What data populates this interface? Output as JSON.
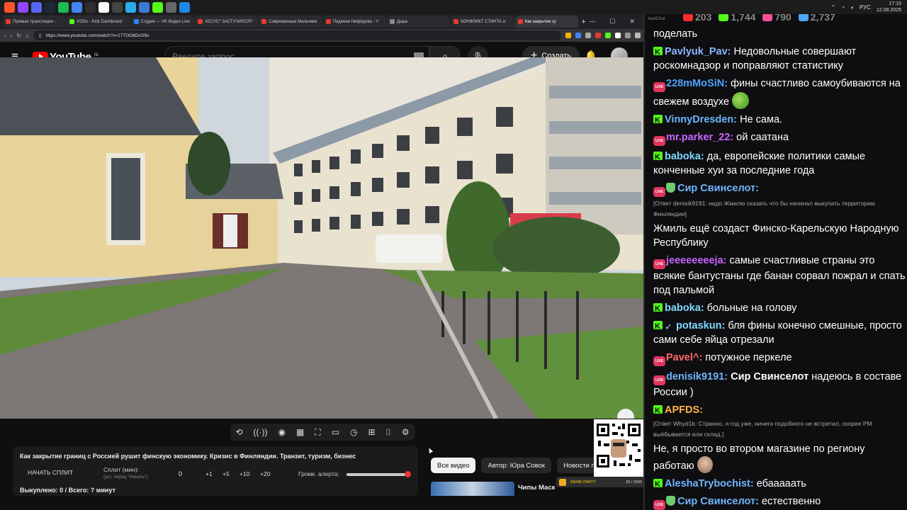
{
  "taskbar": {
    "icons": [
      "brave-icon",
      "twitch-icon",
      "discord-icon",
      "steam-icon",
      "spotify-icon",
      "chrome-icon",
      "obs-icon",
      "capcut-icon",
      "app-icon",
      "telegram-icon",
      "media-icon",
      "kick-icon",
      "game-icon",
      "network-icon"
    ],
    "tray_lang": "РУС",
    "time": "17:15",
    "date": "12.08.2025"
  },
  "browser": {
    "tabs": [
      {
        "label": "Прямые трансляции -",
        "color": "#e53935",
        "active": false
      },
      {
        "label": "VODs - Kick Dashboard",
        "color": "#53fc18",
        "active": false
      },
      {
        "label": "Студия — VK Видео Live",
        "color": "#2787f5",
        "active": false
      },
      {
        "label": "ХЕСУС* ЗАСТУЧИЛСЯ?",
        "color": "#e53935",
        "active": false
      },
      {
        "label": "Современные Мальчики",
        "color": "#e53935",
        "active": false
      },
      {
        "label": "Падение Нифёдова - Y",
        "color": "#e53935",
        "active": false
      },
      {
        "label": "Дыра",
        "color": "#888888",
        "active": false
      },
      {
        "label": "КОНФЛИКТ СТИНТА и",
        "color": "#e53935",
        "active": false
      },
      {
        "label": "Как закрытие гр",
        "color": "#e53935",
        "active": true
      }
    ],
    "url": "https://www.youtube.com/watch?v=17TOO6DvS9o"
  },
  "youtube": {
    "logo_text": "YouTube",
    "logo_region": "NL",
    "search_placeholder": "Введите запрос",
    "create_label": "Создать"
  },
  "panel": {
    "title": "Как закрытие границ с Россией рушит финскую экономику. Кризис в Финляндии. Транзит, туризм, бизнес",
    "split_button": "НАЧАТЬ СПЛИТ",
    "split_label": "Сплит (мин):",
    "split_sub": "(уст. перед \"Начать\")",
    "split_value": "0",
    "increments": [
      "+1",
      "+5",
      "+10",
      "+20"
    ],
    "volume_label": "Громк. алерта:",
    "volume_level": 0.95,
    "bought": "Выкуплено: 0 / Всего: ? минут"
  },
  "chips": [
    "Все видео",
    "Автор: Юра Совок",
    "Новости п"
  ],
  "recommend_title": "Чипы Маск",
  "badge": {
    "label": "MEME PARTY",
    "count": "20 / 1500"
  },
  "chat": {
    "app_label": "AxelChat",
    "stats": [
      {
        "icon": "youtube-icon",
        "value": "203",
        "color": "#ff2b2b"
      },
      {
        "icon": "kick-icon",
        "value": "1,744",
        "color": "#53fc18"
      },
      {
        "icon": "vk-live-icon",
        "value": "790",
        "color": "#ff4f9a"
      },
      {
        "icon": "users-icon",
        "value": "2,737",
        "color": "#4aa8ff"
      }
    ],
    "messages": [
      {
        "badges": [],
        "user": "",
        "color": "#ffffff",
        "reply": "",
        "text": "поделать",
        "emote": ""
      },
      {
        "badges": [
          "kick"
        ],
        "user": "Pavlyuk_Pav:",
        "color": "#8ab8ff",
        "reply": "",
        "text": "Недовольные совершают роскомнадзор и поправляют статистику",
        "emote": ""
      },
      {
        "badges": [
          "live"
        ],
        "user": "228mMoSiN:",
        "color": "#4fa3ff",
        "reply": "",
        "text": "фины счастливо самоубиваются на свежем воздухе",
        "emote": "frog"
      },
      {
        "badges": [
          "kick"
        ],
        "user": "VinnyDresden:",
        "color": "#6eb6ff",
        "reply": "",
        "text": "Не сама.",
        "emote": ""
      },
      {
        "badges": [
          "live"
        ],
        "user": "mr.parker_22:",
        "color": "#c764ff",
        "reply": "",
        "text": "ой саатана",
        "emote": ""
      },
      {
        "badges": [
          "kick"
        ],
        "user": "baboka:",
        "color": "#7fd9ff",
        "reply": "",
        "text": "да, европейские политики самые конченные хуи за последние года",
        "emote": ""
      },
      {
        "badges": [
          "live",
          "shield"
        ],
        "user": "Сир Свинселот:",
        "color": "#6eb6ff",
        "reply": "[Ответ denisik9191: надо Жмилю сказать что бы начинал выкупать территорию Финляндии]",
        "text": "Жмиль ещё создаст Финско-Карельскую Народную Республику",
        "emote": ""
      },
      {
        "badges": [
          "live"
        ],
        "user": "jeeeeeeeeja:",
        "color": "#c764ff",
        "reply": "",
        "text": "самые счастливые страны это всякие бантустаны где банан сорвал пожрал и спать под пальмой",
        "emote": ""
      },
      {
        "badges": [
          "kick"
        ],
        "user": "baboka:",
        "color": "#7fd9ff",
        "reply": "",
        "text": "больные на голову",
        "emote": ""
      },
      {
        "badges": [
          "kick",
          "rocket"
        ],
        "user": "potaskun:",
        "color": "#7fd9ff",
        "reply": "",
        "text": "бля фины конечно смешные, просто сами себе яйца отрезали",
        "emote": ""
      },
      {
        "badges": [
          "live"
        ],
        "user": "Pavel^:",
        "color": "#ff6b6b",
        "reply": "",
        "text": "потужное перкеле",
        "emote": ""
      },
      {
        "badges": [
          "live"
        ],
        "user": "denisik9191:",
        "color": "#6eb6ff",
        "reply": "",
        "text": "Сир Свинселот надеюсь в составе России )",
        "emote": "",
        "mention": "Сир Свинселот"
      },
      {
        "badges": [
          "kick"
        ],
        "user": "APFDS:",
        "color": "#ffb347",
        "reply": "[Ответ Whyd1k: Странно, я год уже, ничего подобного не встретил, скорее РМ выёбывается или склад.]",
        "text": "Не, я просто во втором магазине по региону работаю",
        "emote": "face"
      },
      {
        "badges": [
          "kick"
        ],
        "user": "AleshaTrybochist:",
        "color": "#6eb6ff",
        "reply": "",
        "text": "ебааааать",
        "emote": ""
      },
      {
        "badges": [
          "live",
          "shield"
        ],
        "user": "Сир Свинселот:",
        "color": "#6eb6ff",
        "reply": "",
        "text": "естественно",
        "emote": ""
      }
    ]
  }
}
